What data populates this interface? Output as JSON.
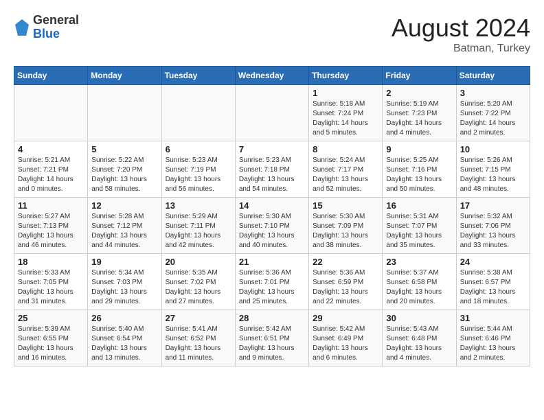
{
  "header": {
    "logo_general": "General",
    "logo_blue": "Blue",
    "title": "August 2024",
    "subtitle": "Batman, Turkey"
  },
  "weekdays": [
    "Sunday",
    "Monday",
    "Tuesday",
    "Wednesday",
    "Thursday",
    "Friday",
    "Saturday"
  ],
  "weeks": [
    [
      {
        "day": "",
        "info": ""
      },
      {
        "day": "",
        "info": ""
      },
      {
        "day": "",
        "info": ""
      },
      {
        "day": "",
        "info": ""
      },
      {
        "day": "1",
        "info": "Sunrise: 5:18 AM\nSunset: 7:24 PM\nDaylight: 14 hours\nand 5 minutes."
      },
      {
        "day": "2",
        "info": "Sunrise: 5:19 AM\nSunset: 7:23 PM\nDaylight: 14 hours\nand 4 minutes."
      },
      {
        "day": "3",
        "info": "Sunrise: 5:20 AM\nSunset: 7:22 PM\nDaylight: 14 hours\nand 2 minutes."
      }
    ],
    [
      {
        "day": "4",
        "info": "Sunrise: 5:21 AM\nSunset: 7:21 PM\nDaylight: 14 hours\nand 0 minutes."
      },
      {
        "day": "5",
        "info": "Sunrise: 5:22 AM\nSunset: 7:20 PM\nDaylight: 13 hours\nand 58 minutes."
      },
      {
        "day": "6",
        "info": "Sunrise: 5:23 AM\nSunset: 7:19 PM\nDaylight: 13 hours\nand 56 minutes."
      },
      {
        "day": "7",
        "info": "Sunrise: 5:23 AM\nSunset: 7:18 PM\nDaylight: 13 hours\nand 54 minutes."
      },
      {
        "day": "8",
        "info": "Sunrise: 5:24 AM\nSunset: 7:17 PM\nDaylight: 13 hours\nand 52 minutes."
      },
      {
        "day": "9",
        "info": "Sunrise: 5:25 AM\nSunset: 7:16 PM\nDaylight: 13 hours\nand 50 minutes."
      },
      {
        "day": "10",
        "info": "Sunrise: 5:26 AM\nSunset: 7:15 PM\nDaylight: 13 hours\nand 48 minutes."
      }
    ],
    [
      {
        "day": "11",
        "info": "Sunrise: 5:27 AM\nSunset: 7:13 PM\nDaylight: 13 hours\nand 46 minutes."
      },
      {
        "day": "12",
        "info": "Sunrise: 5:28 AM\nSunset: 7:12 PM\nDaylight: 13 hours\nand 44 minutes."
      },
      {
        "day": "13",
        "info": "Sunrise: 5:29 AM\nSunset: 7:11 PM\nDaylight: 13 hours\nand 42 minutes."
      },
      {
        "day": "14",
        "info": "Sunrise: 5:30 AM\nSunset: 7:10 PM\nDaylight: 13 hours\nand 40 minutes."
      },
      {
        "day": "15",
        "info": "Sunrise: 5:30 AM\nSunset: 7:09 PM\nDaylight: 13 hours\nand 38 minutes."
      },
      {
        "day": "16",
        "info": "Sunrise: 5:31 AM\nSunset: 7:07 PM\nDaylight: 13 hours\nand 35 minutes."
      },
      {
        "day": "17",
        "info": "Sunrise: 5:32 AM\nSunset: 7:06 PM\nDaylight: 13 hours\nand 33 minutes."
      }
    ],
    [
      {
        "day": "18",
        "info": "Sunrise: 5:33 AM\nSunset: 7:05 PM\nDaylight: 13 hours\nand 31 minutes."
      },
      {
        "day": "19",
        "info": "Sunrise: 5:34 AM\nSunset: 7:03 PM\nDaylight: 13 hours\nand 29 minutes."
      },
      {
        "day": "20",
        "info": "Sunrise: 5:35 AM\nSunset: 7:02 PM\nDaylight: 13 hours\nand 27 minutes."
      },
      {
        "day": "21",
        "info": "Sunrise: 5:36 AM\nSunset: 7:01 PM\nDaylight: 13 hours\nand 25 minutes."
      },
      {
        "day": "22",
        "info": "Sunrise: 5:36 AM\nSunset: 6:59 PM\nDaylight: 13 hours\nand 22 minutes."
      },
      {
        "day": "23",
        "info": "Sunrise: 5:37 AM\nSunset: 6:58 PM\nDaylight: 13 hours\nand 20 minutes."
      },
      {
        "day": "24",
        "info": "Sunrise: 5:38 AM\nSunset: 6:57 PM\nDaylight: 13 hours\nand 18 minutes."
      }
    ],
    [
      {
        "day": "25",
        "info": "Sunrise: 5:39 AM\nSunset: 6:55 PM\nDaylight: 13 hours\nand 16 minutes."
      },
      {
        "day": "26",
        "info": "Sunrise: 5:40 AM\nSunset: 6:54 PM\nDaylight: 13 hours\nand 13 minutes."
      },
      {
        "day": "27",
        "info": "Sunrise: 5:41 AM\nSunset: 6:52 PM\nDaylight: 13 hours\nand 11 minutes."
      },
      {
        "day": "28",
        "info": "Sunrise: 5:42 AM\nSunset: 6:51 PM\nDaylight: 13 hours\nand 9 minutes."
      },
      {
        "day": "29",
        "info": "Sunrise: 5:42 AM\nSunset: 6:49 PM\nDaylight: 13 hours\nand 6 minutes."
      },
      {
        "day": "30",
        "info": "Sunrise: 5:43 AM\nSunset: 6:48 PM\nDaylight: 13 hours\nand 4 minutes."
      },
      {
        "day": "31",
        "info": "Sunrise: 5:44 AM\nSunset: 6:46 PM\nDaylight: 13 hours\nand 2 minutes."
      }
    ]
  ]
}
